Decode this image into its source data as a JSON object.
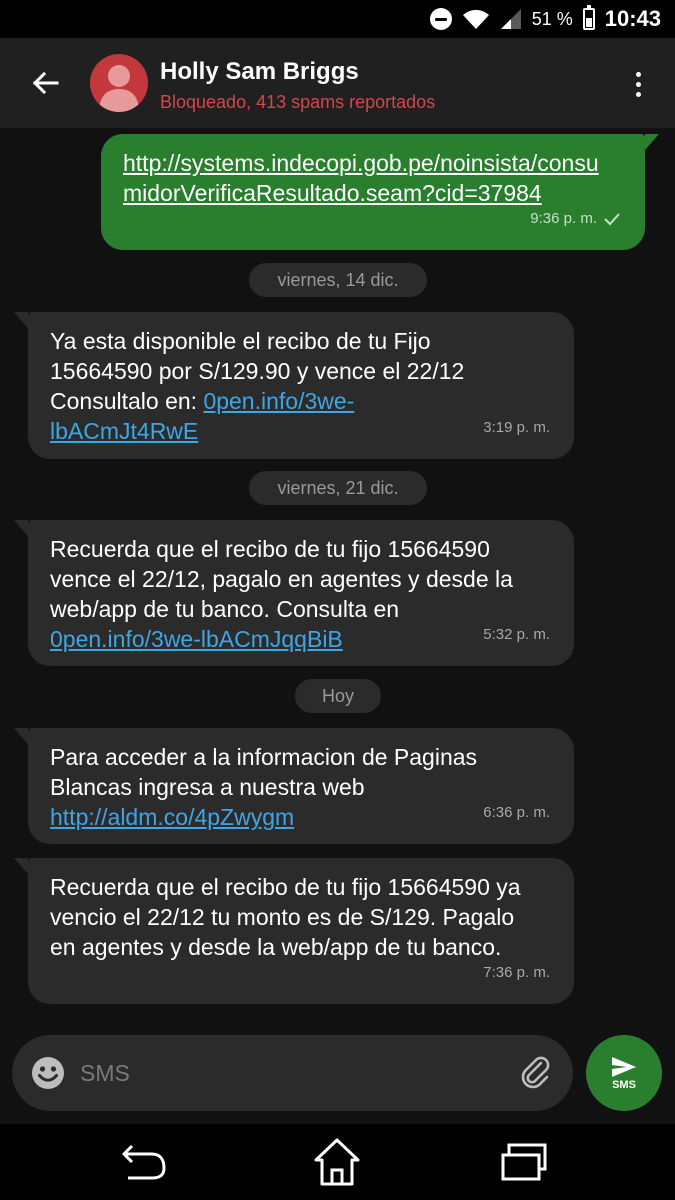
{
  "status_bar": {
    "battery_percent": "51 %",
    "time": "10:43",
    "icons": [
      "do-not-disturb-icon",
      "wifi-icon",
      "cellular-signal-icon",
      "battery-icon"
    ]
  },
  "app_bar": {
    "contact_name": "Holly Sam Briggs",
    "contact_status": "Bloqueado, 413 spams reportados",
    "status_color": "#d1474a",
    "avatar_color": "#c3383c"
  },
  "thread": {
    "outgoing": {
      "link": "http://systems.indecopi.gob.pe/noinsista/consumidorVerificaResultado.seam?cid=37984",
      "time": "9:36 p. m."
    },
    "date_chips": [
      "viernes, 14 dic.",
      "viernes, 21 dic.",
      "Hoy"
    ],
    "incoming": [
      {
        "text": "Ya esta disponible el recibo de tu Fijo 15664590 por S/129.90 y vence el 22/12 Consultalo en: ",
        "link": "0pen.info/3we-lbACmJt4RwE",
        "time": "3:19 p. m."
      },
      {
        "text": "Recuerda que el recibo de tu fijo 15664590 vence el 22/12, pagalo en agentes y desde la web/app de tu banco. Consulta en ",
        "link": "0pen.info/3we-lbACmJqqBiB",
        "time": "5:32 p. m."
      },
      {
        "text": "Para acceder a la informacion de Paginas Blancas ingresa a nuestra web ",
        "link": "http://aldm.co/4pZwygm",
        "time": "6:36 p. m."
      },
      {
        "text": "Recuerda que el recibo de tu fijo 15664590 ya vencio el 22/12 tu monto es de S/129. Pagalo en agentes y desde la web/app de tu banco.",
        "link": "",
        "time": "7:36 p. m."
      }
    ]
  },
  "compose": {
    "placeholder": "SMS",
    "send_label": "SMS"
  },
  "colors": {
    "accent_green": "#2a7f2f",
    "link_blue": "#3ea6e6",
    "bubble_gray": "#2b2b2b"
  }
}
